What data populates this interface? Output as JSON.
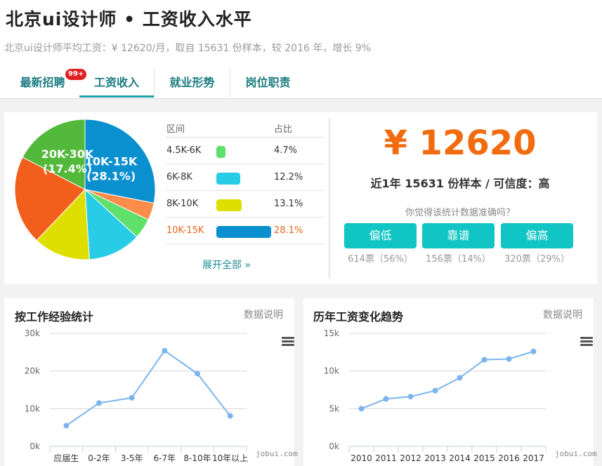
{
  "page": {
    "title": "北京ui设计师 • 工资收入水平",
    "subtitle": "北京ui设计师平均工资：¥ 12620/月，取自 15631 份样本，较 2016 年，增长 9%"
  },
  "tabs": [
    {
      "label": "最新招聘",
      "badge": "99+"
    },
    {
      "label": "工资收入",
      "active": true
    },
    {
      "label": "就业形势"
    },
    {
      "label": "岗位职责"
    }
  ],
  "distribution": {
    "header_range": "区间",
    "header_pct": "占比",
    "rows": [
      {
        "range": "4.5K-6K",
        "pct": "4.7%",
        "value": 4.7,
        "color": "#5fe06a"
      },
      {
        "range": "6K-8K",
        "pct": "12.2%",
        "value": 12.2,
        "color": "#28cce6"
      },
      {
        "range": "8K-10K",
        "pct": "13.1%",
        "value": 13.1,
        "color": "#dedf00"
      },
      {
        "range": "10K-15K",
        "pct": "28.1%",
        "value": 28.1,
        "color": "#0a8fcf",
        "highlight": true
      }
    ],
    "expand_label": "展开全部 »"
  },
  "pie_chart_data": {
    "type": "pie",
    "slices": [
      {
        "label": "10K-15K",
        "value": 28.1,
        "color": "#0a8fcf",
        "show_label": true
      },
      {
        "label": "",
        "value": 4.0,
        "color": "#fb8c4a"
      },
      {
        "label": "4.5K-6K",
        "value": 4.7,
        "color": "#5fe06a"
      },
      {
        "label": "6K-8K",
        "value": 12.2,
        "color": "#28cce6"
      },
      {
        "label": "8K-10K",
        "value": 13.1,
        "color": "#dedf00"
      },
      {
        "label": "",
        "value": 20.5,
        "color": "#f25f1c"
      },
      {
        "label": "20K-30K",
        "value": 17.4,
        "color": "#52b93a",
        "show_label": true
      }
    ]
  },
  "salary": {
    "amount": "¥ 12620",
    "sample_text": "近1年 15631 份样本 / 可信度：高",
    "question": "你觉得该统计数据准确吗？",
    "votes": [
      {
        "label": "偏低",
        "result": "614票（56%）"
      },
      {
        "label": "靠谱",
        "result": "156票（14%）"
      },
      {
        "label": "偏高",
        "result": "320票（29%）"
      }
    ]
  },
  "experience_chart": {
    "title": "按工作经验统计",
    "link": "数据说明",
    "credit": "jobui.com",
    "chart_data": {
      "type": "line",
      "categories": [
        "应届生",
        "0-2年",
        "3-5年",
        "6-7年",
        "8-10年",
        "10年以上"
      ],
      "values": [
        5500,
        11500,
        12900,
        25400,
        19300,
        8100
      ],
      "ylim": [
        0,
        30000
      ],
      "yticks": [
        "0k",
        "10k",
        "20k",
        "30k"
      ],
      "color": "#7cb5ec",
      "grid": true
    }
  },
  "trend_chart": {
    "title": "历年工资变化趋势",
    "link": "数据说明",
    "credit": "jobui.com",
    "chart_data": {
      "type": "line",
      "categories": [
        "2010",
        "2011",
        "2012",
        "2013",
        "2014",
        "2015",
        "2016",
        "2017"
      ],
      "values": [
        5000,
        6300,
        6600,
        7400,
        9100,
        11500,
        11600,
        12600
      ],
      "ylim": [
        0,
        15000
      ],
      "yticks": [
        "0k",
        "5k",
        "10k",
        "15k"
      ],
      "color": "#7cb5ec",
      "grid": true
    }
  }
}
